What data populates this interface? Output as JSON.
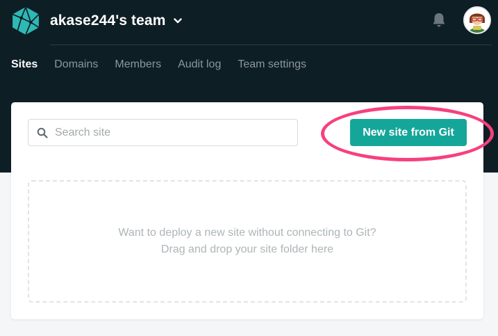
{
  "team": {
    "name": "akase244's team"
  },
  "nav": {
    "items": [
      {
        "label": "Sites",
        "active": true
      },
      {
        "label": "Domains",
        "active": false
      },
      {
        "label": "Members",
        "active": false
      },
      {
        "label": "Audit log",
        "active": false
      },
      {
        "label": "Team settings",
        "active": false
      }
    ]
  },
  "search": {
    "placeholder": "Search site",
    "value": ""
  },
  "actions": {
    "new_site_label": "New site from Git"
  },
  "dropzone": {
    "line1": "Want to deploy a new site without connecting to Git?",
    "line2": "Drag and drop your site folder here"
  },
  "icons": {
    "logo": "netlify-logo-icon",
    "team_menu": "chevron-down-icon",
    "notifications": "bell-icon",
    "search": "search-icon"
  },
  "colors": {
    "header_bg": "#0e1e25",
    "primary_button": "#15a69a",
    "highlight_ring": "#f7407d",
    "page_bg": "#f5f6f7"
  }
}
